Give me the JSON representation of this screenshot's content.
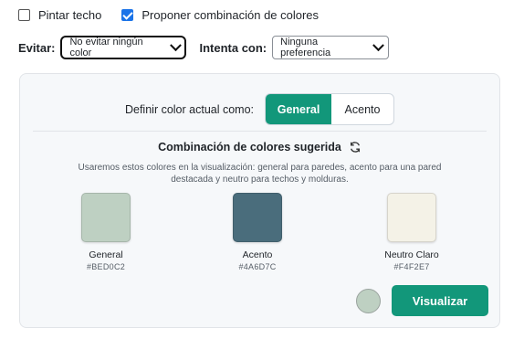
{
  "options": {
    "ceiling_label": "Pintar techo",
    "ceiling_checked": false,
    "propose_label": "Proponer combinación de colores",
    "propose_checked": true
  },
  "filters": {
    "avoid_label": "Evitar:",
    "avoid_value": "No evitar ningún color",
    "try_label": "Intenta con:",
    "try_value": "Ninguna preferencia"
  },
  "panel": {
    "define_label": "Definir color actual como:",
    "segments": [
      "General",
      "Acento"
    ],
    "active_segment": "General",
    "suggestion_title": "Combinación de colores sugerida",
    "description": "Usaremos estos colores en la visualización: general para paredes, acento para una pared destacada y neutro para techos y molduras.",
    "swatches": [
      {
        "name": "General",
        "hex": "#BED0C2"
      },
      {
        "name": "Acento",
        "hex": "#4A6D7C"
      },
      {
        "name": "Neutro Claro",
        "hex": "#F4F2E7"
      }
    ],
    "current_color": "#BED0C2",
    "visualize_label": "Visualizar"
  },
  "colors": {
    "accent": "#12977a",
    "checkbox": "#1a73e8"
  },
  "icons": {
    "refresh": "refresh-icon",
    "chevron": "chevron-down-icon"
  }
}
